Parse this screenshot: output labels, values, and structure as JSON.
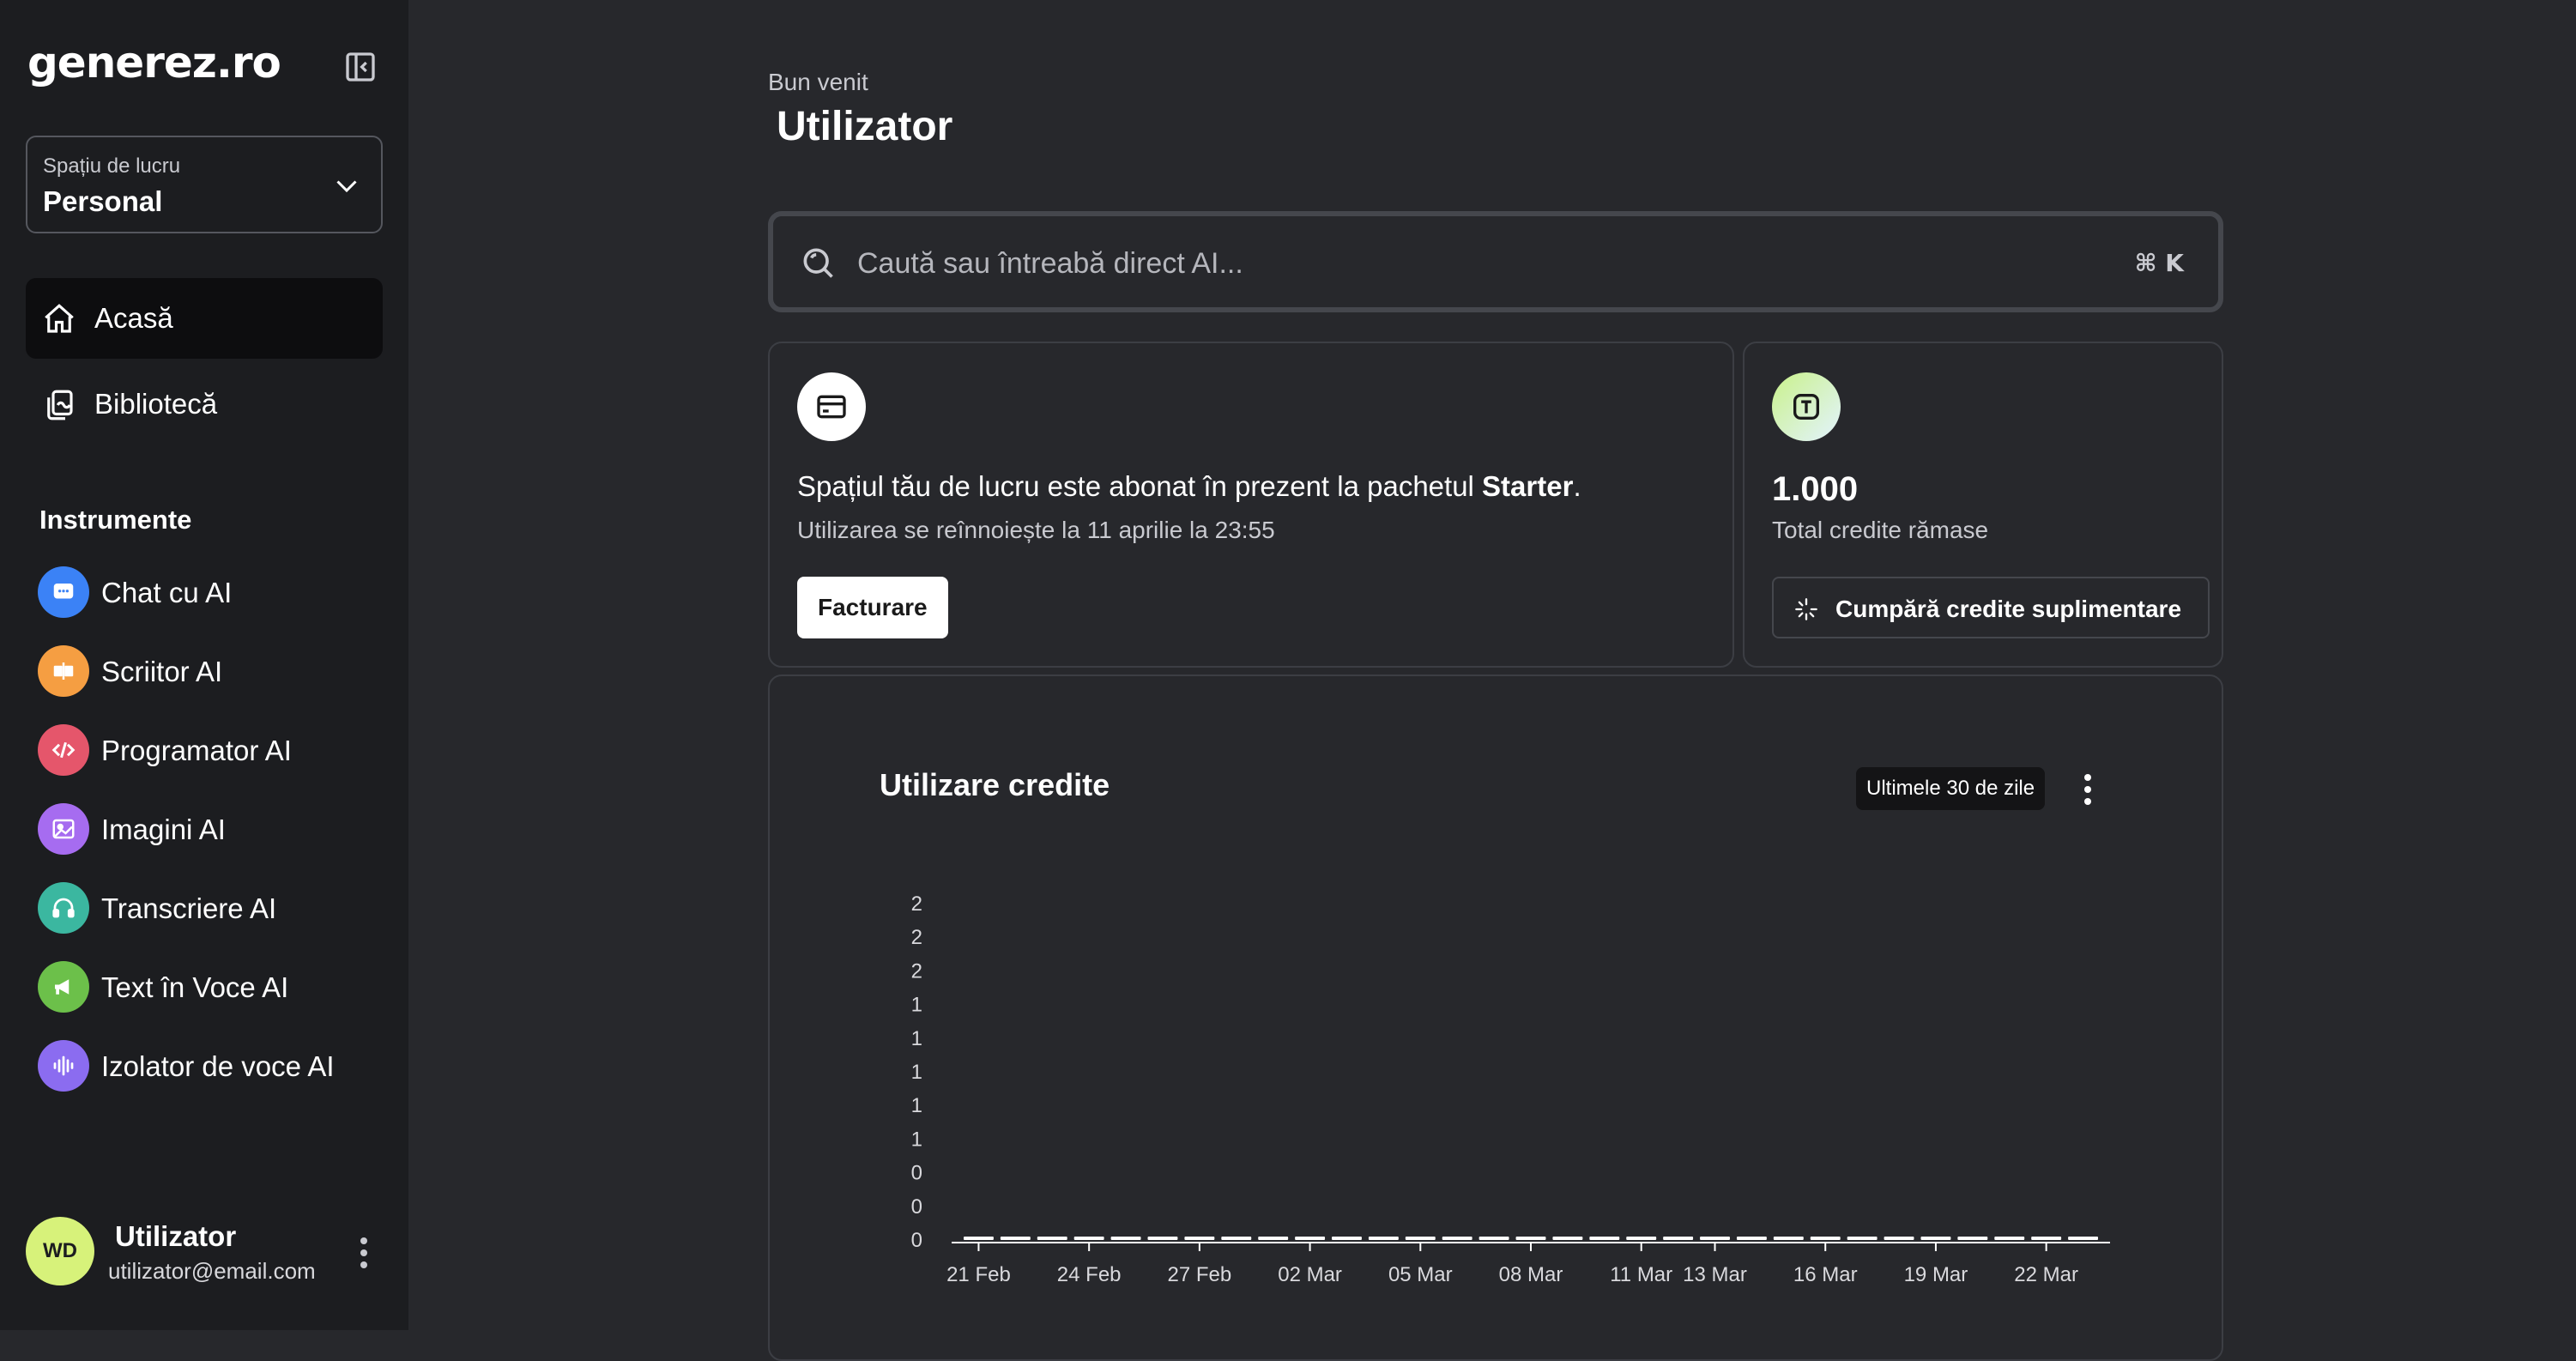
{
  "app": {
    "logo": "enerez.ro",
    "logo_g": "g"
  },
  "workspace": {
    "label": "Spațiu de lucru",
    "value": "Personal"
  },
  "nav": [
    {
      "label": "Acasă",
      "icon": "home-icon",
      "active": true
    },
    {
      "label": "Bibliotecă",
      "icon": "library-icon",
      "active": false
    }
  ],
  "tools": {
    "title": "Instrumente",
    "items": [
      {
        "label": "Chat cu AI",
        "color": "#3b82f6"
      },
      {
        "label": "Scriitor AI",
        "color": "#f59e42"
      },
      {
        "label": "Programator AI",
        "color": "#e5566b"
      },
      {
        "label": "Imagini AI",
        "color": "#a66cf0"
      },
      {
        "label": "Transcriere AI",
        "color": "#3bb7a0"
      },
      {
        "label": "Text în Voce AI",
        "color": "#6cc04a"
      },
      {
        "label": "Izolator de voce AI",
        "color": "#8b6cf0"
      }
    ]
  },
  "user": {
    "initials": "WD",
    "name": "Utilizator",
    "email": "utilizator@email.com"
  },
  "main": {
    "welcome": "Bun venit",
    "title": "Utilizator",
    "search_placeholder": "Caută sau întreabă direct AI...",
    "search_shortcut": "⌘ K"
  },
  "plan": {
    "text_prefix": "Spațiul tău de lucru este abonat în prezent la pachetul ",
    "plan_name": "Starter",
    "text_suffix": ".",
    "renew": "Utilizarea se reînnoiește la 11 aprilie la 23:55",
    "billing_button": "Facturare"
  },
  "credits": {
    "value": "1.000",
    "label": "Total credite rămase",
    "buy_button": "Cumpără credite suplimentare"
  },
  "chart_data": {
    "type": "bar",
    "title": "Utilizare credite",
    "range_label": "Ultimele 30 de zile",
    "ytick_labels": [
      "2",
      "2",
      "2",
      "1",
      "1",
      "1",
      "1",
      "1",
      "0",
      "0",
      "0"
    ],
    "ylim": [
      0,
      2
    ],
    "xtick_labels": [
      "21 Feb",
      "24 Feb",
      "27 Feb",
      "02 Mar",
      "05 Mar",
      "08 Mar",
      "11 Mar",
      "13 Mar",
      "16 Mar",
      "19 Mar",
      "22 Mar"
    ],
    "xtick_day_index": [
      0,
      3,
      6,
      9,
      12,
      15,
      18,
      20,
      23,
      26,
      29
    ],
    "num_days": 31,
    "values": [
      0,
      0,
      0,
      0,
      0,
      0,
      0,
      0,
      0,
      0,
      0,
      0,
      0,
      0,
      0,
      0,
      0,
      0,
      0,
      0,
      0,
      0,
      0,
      0,
      0,
      0,
      0,
      0,
      0,
      0,
      0
    ]
  }
}
